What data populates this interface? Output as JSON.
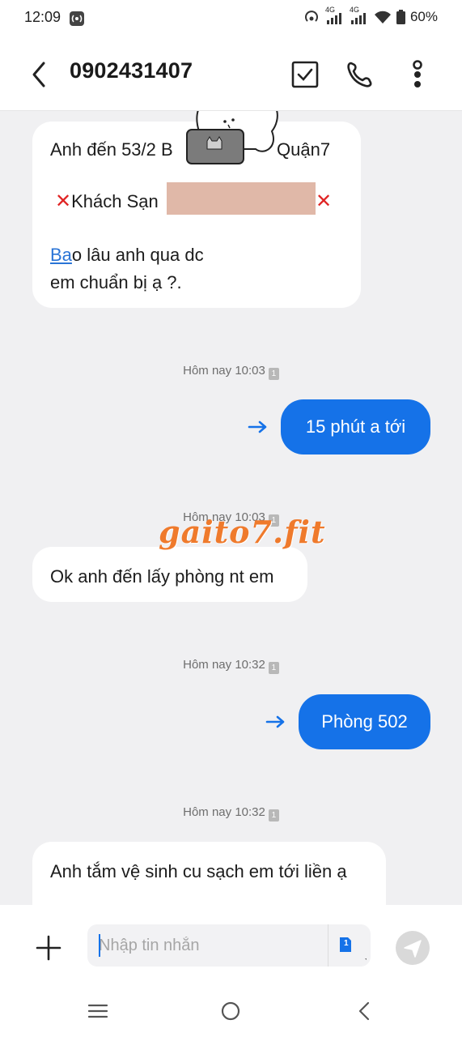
{
  "status_bar": {
    "time": "12:09",
    "battery": "60%",
    "network_1": "4G",
    "network_2": "4G"
  },
  "header": {
    "contact": "0902431407",
    "icons": [
      "back-arrow-icon",
      "checkbox-icon",
      "phone-icon",
      "more-vert-icon"
    ]
  },
  "messages": [
    {
      "direction": "incoming",
      "line1": "Anh đến 53/2 B",
      "line1_end": "Quận7",
      "line2": "Khách Sạn",
      "line3_link": "Ba",
      "line3_rest": "o lâu anh qua dc",
      "line4": "em chuẩn bị ạ ?."
    },
    {
      "direction": "timestamp",
      "text": "Hôm nay 10:03",
      "sim": "1"
    },
    {
      "direction": "outgoing",
      "text": "15 phút a tới"
    },
    {
      "direction": "timestamp",
      "text": "Hôm nay 10:03",
      "sim": "1"
    },
    {
      "direction": "incoming",
      "text": "Ok anh đến lấy phòng nt em"
    },
    {
      "direction": "timestamp",
      "text": "Hôm nay 10:32",
      "sim": "1"
    },
    {
      "direction": "outgoing",
      "text": "Phòng 502"
    },
    {
      "direction": "timestamp",
      "text": "Hôm nay 10:32",
      "sim": "1"
    },
    {
      "direction": "incoming",
      "text": "Anh tắm vệ sinh cu sạch em tới liền ạ"
    }
  ],
  "watermark": "gaito7.fit",
  "composer": {
    "placeholder": "Nhập tin nhắn",
    "sim_label": "1"
  },
  "colors": {
    "outgoing_bubble": "#1572e8",
    "chat_background": "#f0f0f2",
    "x_mark": "#e02424",
    "watermark": "#ef7a2c"
  }
}
